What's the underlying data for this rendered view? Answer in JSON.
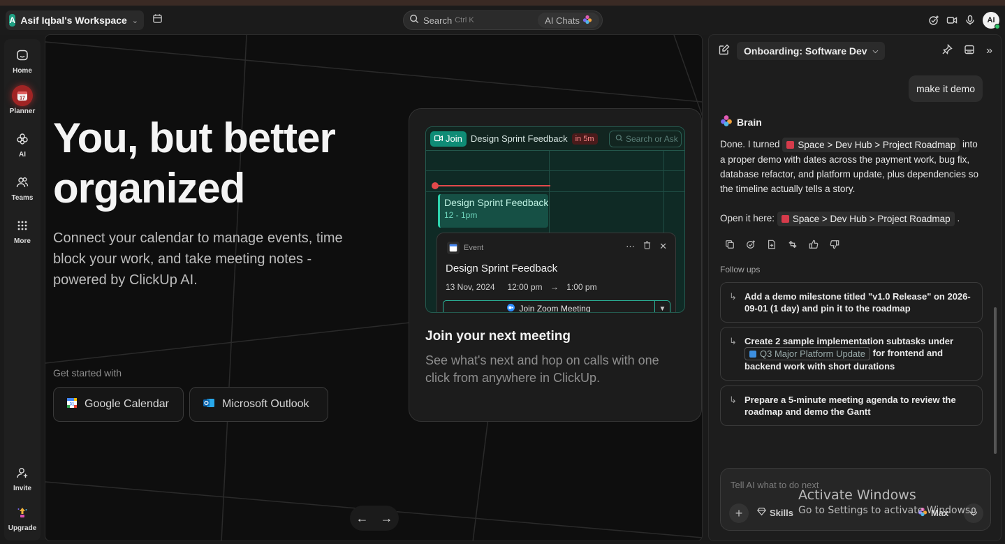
{
  "colors": {
    "accent": "#1fa184",
    "planner_red": "#a02424",
    "now_line": "#e2494b",
    "preview_bg": "#0f2a25",
    "zoom_border": "#2bb59a"
  },
  "topbar": {
    "workspace_initial": "A",
    "workspace_name": "Asif Iqbal's Workspace",
    "search_label": "Search",
    "search_shortcut": "Ctrl K",
    "ai_chats_label": "AI Chats",
    "user_initials": "AI"
  },
  "sidebar": {
    "items": [
      {
        "label": "Home",
        "icon": "home-icon"
      },
      {
        "label": "Planner",
        "icon": "calendar-icon",
        "badge": "17"
      },
      {
        "label": "AI",
        "icon": "ai-brain-icon"
      },
      {
        "label": "Teams",
        "icon": "teams-icon"
      },
      {
        "label": "More",
        "icon": "grid-dots-icon"
      }
    ],
    "bottom": [
      {
        "label": "Invite",
        "icon": "add-user-icon"
      },
      {
        "label": "Upgrade",
        "icon": "upgrade-icon"
      }
    ]
  },
  "hero": {
    "title": "You, but better organized",
    "subtitle": "Connect your calendar to manage events, time block your work, and take meeting notes - powered by ClickUp AI.",
    "get_started": "Get started with",
    "integrations": [
      "Google Calendar",
      "Microsoft Outlook"
    ]
  },
  "card": {
    "preview": {
      "join": "Join",
      "meeting_title": "Design Sprint Feedback",
      "badge": "in 5m",
      "search_placeholder": "Search or Ask",
      "event_title": "Design Sprint Feedback",
      "event_time": "12 - 1pm",
      "popup": {
        "kind": "Event",
        "title": "Design Sprint Feedback",
        "date": "13 Nov, 2024",
        "start": "12:00 pm",
        "end": "1:00 pm",
        "zoom_label": "Join Zoom Meeting"
      }
    },
    "title": "Join your next meeting",
    "description": "See what's next and hop on calls with one click from anywhere in ClickUp."
  },
  "panel": {
    "chat_title": "Onboarding: Software Dev",
    "user_message": "make it demo",
    "assistant_name": "Brain",
    "message": {
      "p1_before": "Done. I turned",
      "p1_chip": "Space > Dev Hub > Project Roadmap",
      "p1_after": "into a proper demo with dates across the payment work, bug fix, database refactor, and platform update, plus dependencies so the timeline actually tells a story.",
      "p2_before": "Open it here:",
      "p2_chip": "Space > Dev Hub > Project Roadmap",
      "p2_after": "."
    },
    "followups_label": "Follow ups",
    "followups": {
      "f1": "Add a demo milestone titled \"v1.0 Release\" on 2026-09-01 (1 day) and pin it to the roadmap",
      "f2_before": "Create 2 sample implementation subtasks under",
      "f2_chip": "Q3 Major Platform Update",
      "f2_after": "for frontend and backend work with short durations",
      "f3": "Prepare a 5-minute meeting agenda to review the roadmap and demo the Gantt"
    },
    "composer": {
      "placeholder": "Tell AI what to do next",
      "skills": "Skills",
      "model": "Max"
    }
  },
  "watermark": {
    "line1": "Activate Windows",
    "line2": "Go to Settings to activate Windows."
  }
}
